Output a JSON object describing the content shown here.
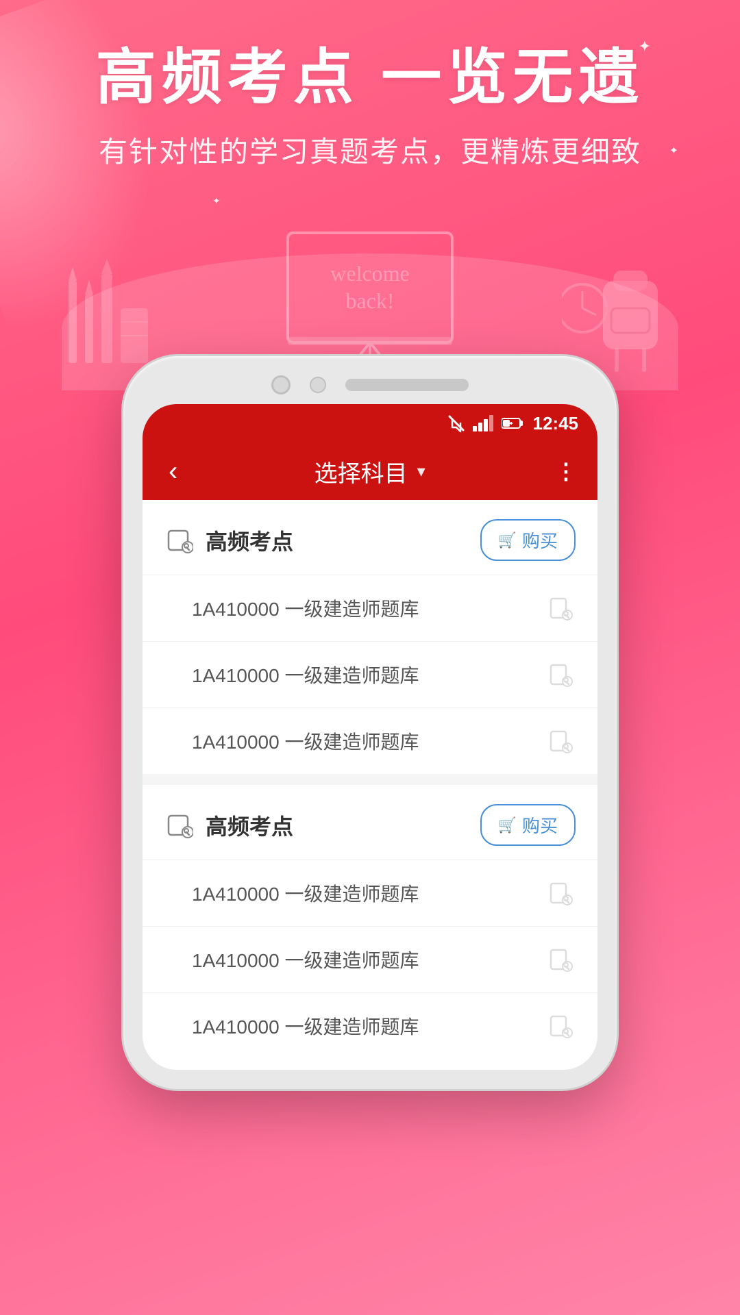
{
  "background": {
    "gradient_from": "#ff6b8a",
    "gradient_to": "#ff4b7b"
  },
  "top_section": {
    "headline": "高频考点 一览无遗",
    "subheadline": "有针对性的学习真题考点，更精炼更细致",
    "welcome_back": "Welcome back"
  },
  "stars": [
    "✦",
    "✦",
    "✦"
  ],
  "status_bar": {
    "time": "12:45",
    "icons": [
      "mute",
      "signal",
      "battery"
    ]
  },
  "app_header": {
    "back_icon": "‹",
    "title": "选择科目",
    "chevron": "∨",
    "more_icon": "⋮"
  },
  "sections": [
    {
      "id": "section1",
      "title": "高频考点",
      "buy_label": "购买",
      "items": [
        {
          "text": "1A410000  一级建造师题库"
        },
        {
          "text": "1A410000  一级建造师题库"
        },
        {
          "text": "1A410000  一级建造师题库"
        }
      ]
    },
    {
      "id": "section2",
      "title": "高频考点",
      "buy_label": "购买",
      "items": [
        {
          "text": "1A410000  一级建造师题库"
        },
        {
          "text": "1A410000  一级建造师题库"
        },
        {
          "text": "1A410000  一级建造师题库"
        }
      ]
    }
  ]
}
